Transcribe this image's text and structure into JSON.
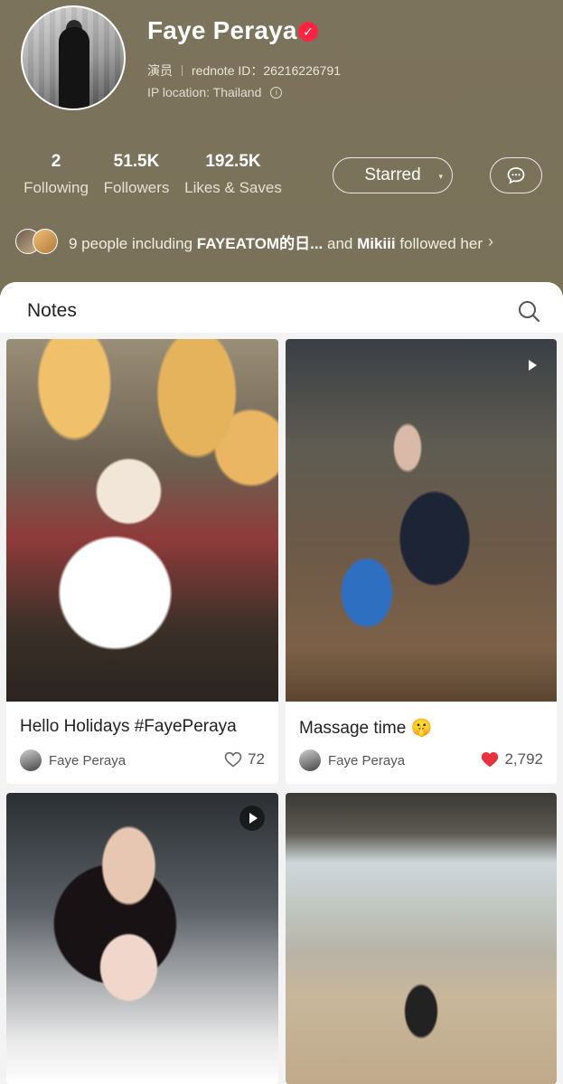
{
  "profile": {
    "name": "Faye Peraya",
    "verified_mark": "✓",
    "role": "演员",
    "rednote_id": "rednote ID：26216226791",
    "ip_location": "IP location: Thailand",
    "info_icon": "i"
  },
  "stats": [
    {
      "value": "2",
      "label": "Following"
    },
    {
      "value": "51.5K",
      "label": "Followers"
    },
    {
      "value": "192.5K",
      "label": "Likes & Saves"
    }
  ],
  "actions": {
    "starred_label": "Starred",
    "caret": "▾",
    "chat_icon": "chat-bubble-icon"
  },
  "followed_by": {
    "prefix": "9 people including ",
    "name1": "FAYEATOM的日...",
    "middle": " and ",
    "name2": "Mikiii",
    "suffix": " followed her",
    "chevron": "›"
  },
  "tabs": {
    "notes": "Notes"
  },
  "notes": [
    {
      "title": "Hello Holidays #FayePeraya",
      "author": "Faye Peraya",
      "likes": "72",
      "liked": false,
      "video": false
    },
    {
      "title": "Massage time 🤫",
      "author": "Faye Peraya",
      "likes": "2,792",
      "liked": true,
      "video": true
    },
    {
      "title": "",
      "author": "",
      "likes": "",
      "liked": false,
      "video": true
    },
    {
      "title": "",
      "author": "",
      "likes": "",
      "liked": false,
      "video": false
    }
  ],
  "colors": {
    "header_bg": "#7b725c",
    "accent_red": "#ff2442",
    "like_red": "#e8323c"
  }
}
